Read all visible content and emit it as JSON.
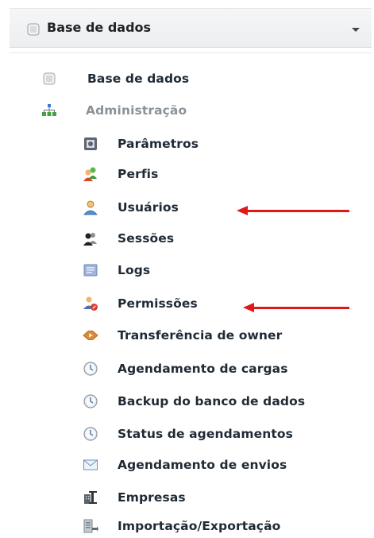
{
  "selector": {
    "label": "Base de dados",
    "icon": "database-icon"
  },
  "menu": {
    "root": {
      "label": "Base de dados",
      "icon": "database-icon"
    },
    "group": {
      "label": "Administração",
      "icon": "sitemap-icon"
    },
    "items": [
      {
        "label": "Parâmetros",
        "icon": "parameters-icon"
      },
      {
        "label": "Perfis",
        "icon": "profiles-icon"
      },
      {
        "label": "Usuários",
        "icon": "user-icon"
      },
      {
        "label": "Sessões",
        "icon": "sessions-icon"
      },
      {
        "label": "Logs",
        "icon": "logs-icon"
      },
      {
        "label": "Permissões",
        "icon": "permissions-icon"
      },
      {
        "label": "Transferência de owner",
        "icon": "transfer-icon"
      },
      {
        "label": "Agendamento de cargas",
        "icon": "clock-icon"
      },
      {
        "label": "Backup do banco de dados",
        "icon": "clock-icon"
      },
      {
        "label": "Status de agendamentos",
        "icon": "clock-icon"
      },
      {
        "label": "Agendamento de envios",
        "icon": "envelope-icon"
      },
      {
        "label": "Empresas",
        "icon": "building-icon"
      },
      {
        "label": "Importação/Exportação",
        "icon": "import-export-icon"
      }
    ]
  },
  "annotations": {
    "arrow_color": "#e01818"
  }
}
